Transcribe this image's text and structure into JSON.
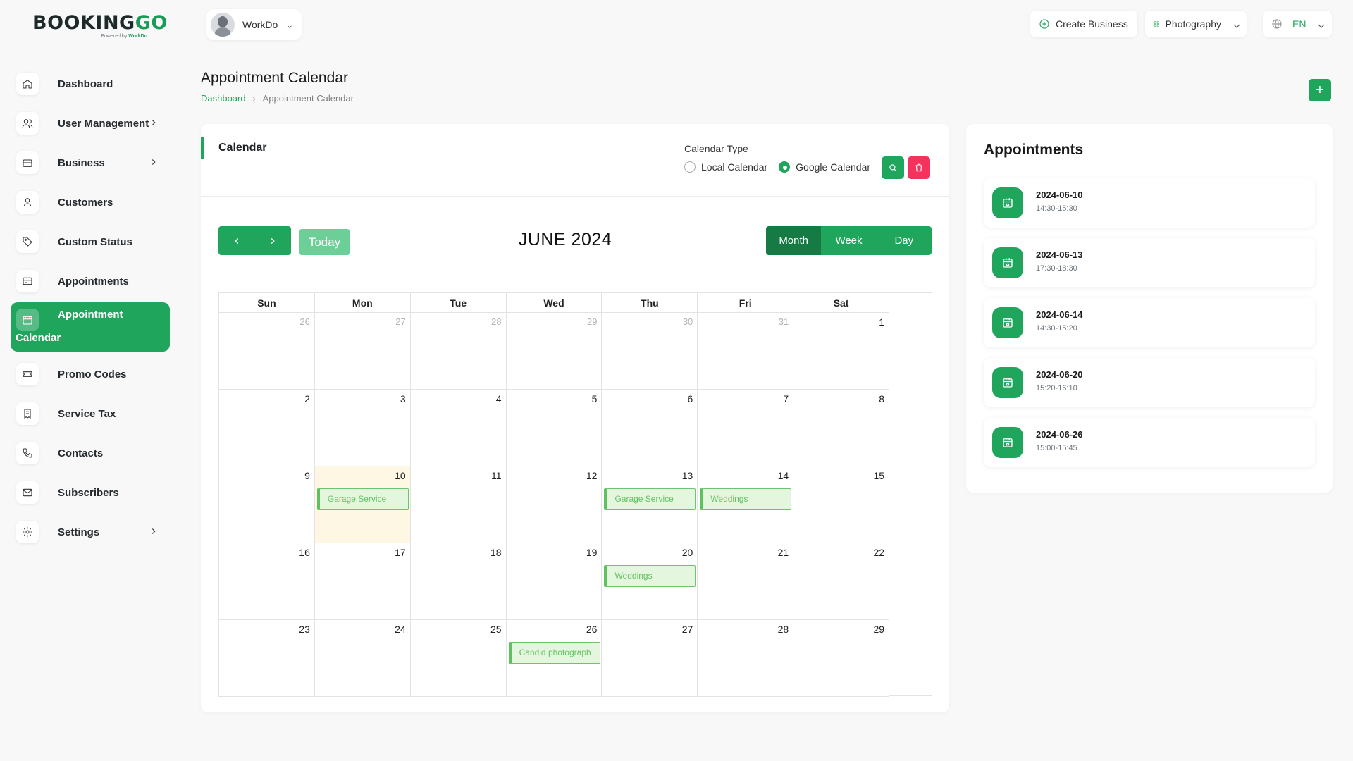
{
  "brand": {
    "logo_main": "BOOKING",
    "logo_accent": "GO",
    "logo_sub_prefix": "Powered by",
    "logo_sub_brand": "WorkDo"
  },
  "header": {
    "user_name": "WorkDo",
    "create_business": "Create Business",
    "category": "Photography",
    "language": "EN"
  },
  "sidebar": {
    "items": [
      {
        "label": "Dashboard",
        "icon": "home-icon"
      },
      {
        "label": "User Management",
        "icon": "users-icon",
        "has_children": true
      },
      {
        "label": "Business",
        "icon": "briefcase-icon",
        "has_children": true
      },
      {
        "label": "Customers",
        "icon": "user-icon"
      },
      {
        "label": "Custom Status",
        "icon": "tag-icon"
      },
      {
        "label": "Appointments",
        "icon": "card-icon"
      },
      {
        "label": "Appointment",
        "label_line2": "Calendar",
        "icon": "calendar-icon",
        "active": true
      },
      {
        "label": "Promo Codes",
        "icon": "ticket-icon"
      },
      {
        "label": "Service Tax",
        "icon": "receipt-icon"
      },
      {
        "label": "Contacts",
        "icon": "phone-icon"
      },
      {
        "label": "Subscribers",
        "icon": "mail-icon"
      },
      {
        "label": "Settings",
        "icon": "gear-icon",
        "has_children": true
      }
    ]
  },
  "page": {
    "title": "Appointment Calendar",
    "breadcrumb": [
      "Dashboard",
      "Appointment Calendar"
    ],
    "add_label": "+"
  },
  "calendar": {
    "card_title": "Calendar",
    "type_label": "Calendar Type",
    "type_options": [
      "Local Calendar",
      "Google Calendar"
    ],
    "type_selected": "Google Calendar",
    "today_label": "Today",
    "month_title": "JUNE 2024",
    "views": [
      "Month",
      "Week",
      "Day"
    ],
    "view_selected": "Month",
    "weekdays": [
      "Sun",
      "Mon",
      "Tue",
      "Wed",
      "Thu",
      "Fri",
      "Sat"
    ],
    "weeks": [
      [
        {
          "d": "26",
          "o": true
        },
        {
          "d": "27",
          "o": true
        },
        {
          "d": "28",
          "o": true
        },
        {
          "d": "29",
          "o": true
        },
        {
          "d": "30",
          "o": true
        },
        {
          "d": "31",
          "o": true
        },
        {
          "d": "1"
        }
      ],
      [
        {
          "d": "2"
        },
        {
          "d": "3"
        },
        {
          "d": "4"
        },
        {
          "d": "5"
        },
        {
          "d": "6"
        },
        {
          "d": "7"
        },
        {
          "d": "8"
        }
      ],
      [
        {
          "d": "9"
        },
        {
          "d": "10",
          "today": true,
          "event": "Garage Service"
        },
        {
          "d": "11"
        },
        {
          "d": "12"
        },
        {
          "d": "13",
          "event": "Garage Service"
        },
        {
          "d": "14",
          "event": "Weddings"
        },
        {
          "d": "15"
        }
      ],
      [
        {
          "d": "16"
        },
        {
          "d": "17"
        },
        {
          "d": "18"
        },
        {
          "d": "19"
        },
        {
          "d": "20",
          "event": "Weddings"
        },
        {
          "d": "21"
        },
        {
          "d": "22"
        }
      ],
      [
        {
          "d": "23"
        },
        {
          "d": "24"
        },
        {
          "d": "25"
        },
        {
          "d": "26",
          "event": "Candid photograph"
        },
        {
          "d": "27"
        },
        {
          "d": "28"
        },
        {
          "d": "29"
        }
      ]
    ]
  },
  "appointments": {
    "title": "Appointments",
    "items": [
      {
        "date": "2024-06-10",
        "time": "14:30-15:30"
      },
      {
        "date": "2024-06-13",
        "time": "17:30-18:30"
      },
      {
        "date": "2024-06-14",
        "time": "14:30-15:20"
      },
      {
        "date": "2024-06-20",
        "time": "15:20-16:10"
      },
      {
        "date": "2024-06-26",
        "time": "15:00-15:45"
      }
    ]
  },
  "colors": {
    "accent": "#1fa55c",
    "danger": "#f5325c",
    "event_bg": "#e5f6df",
    "event_text": "#62c462",
    "today_bg": "#fdf7e3"
  }
}
